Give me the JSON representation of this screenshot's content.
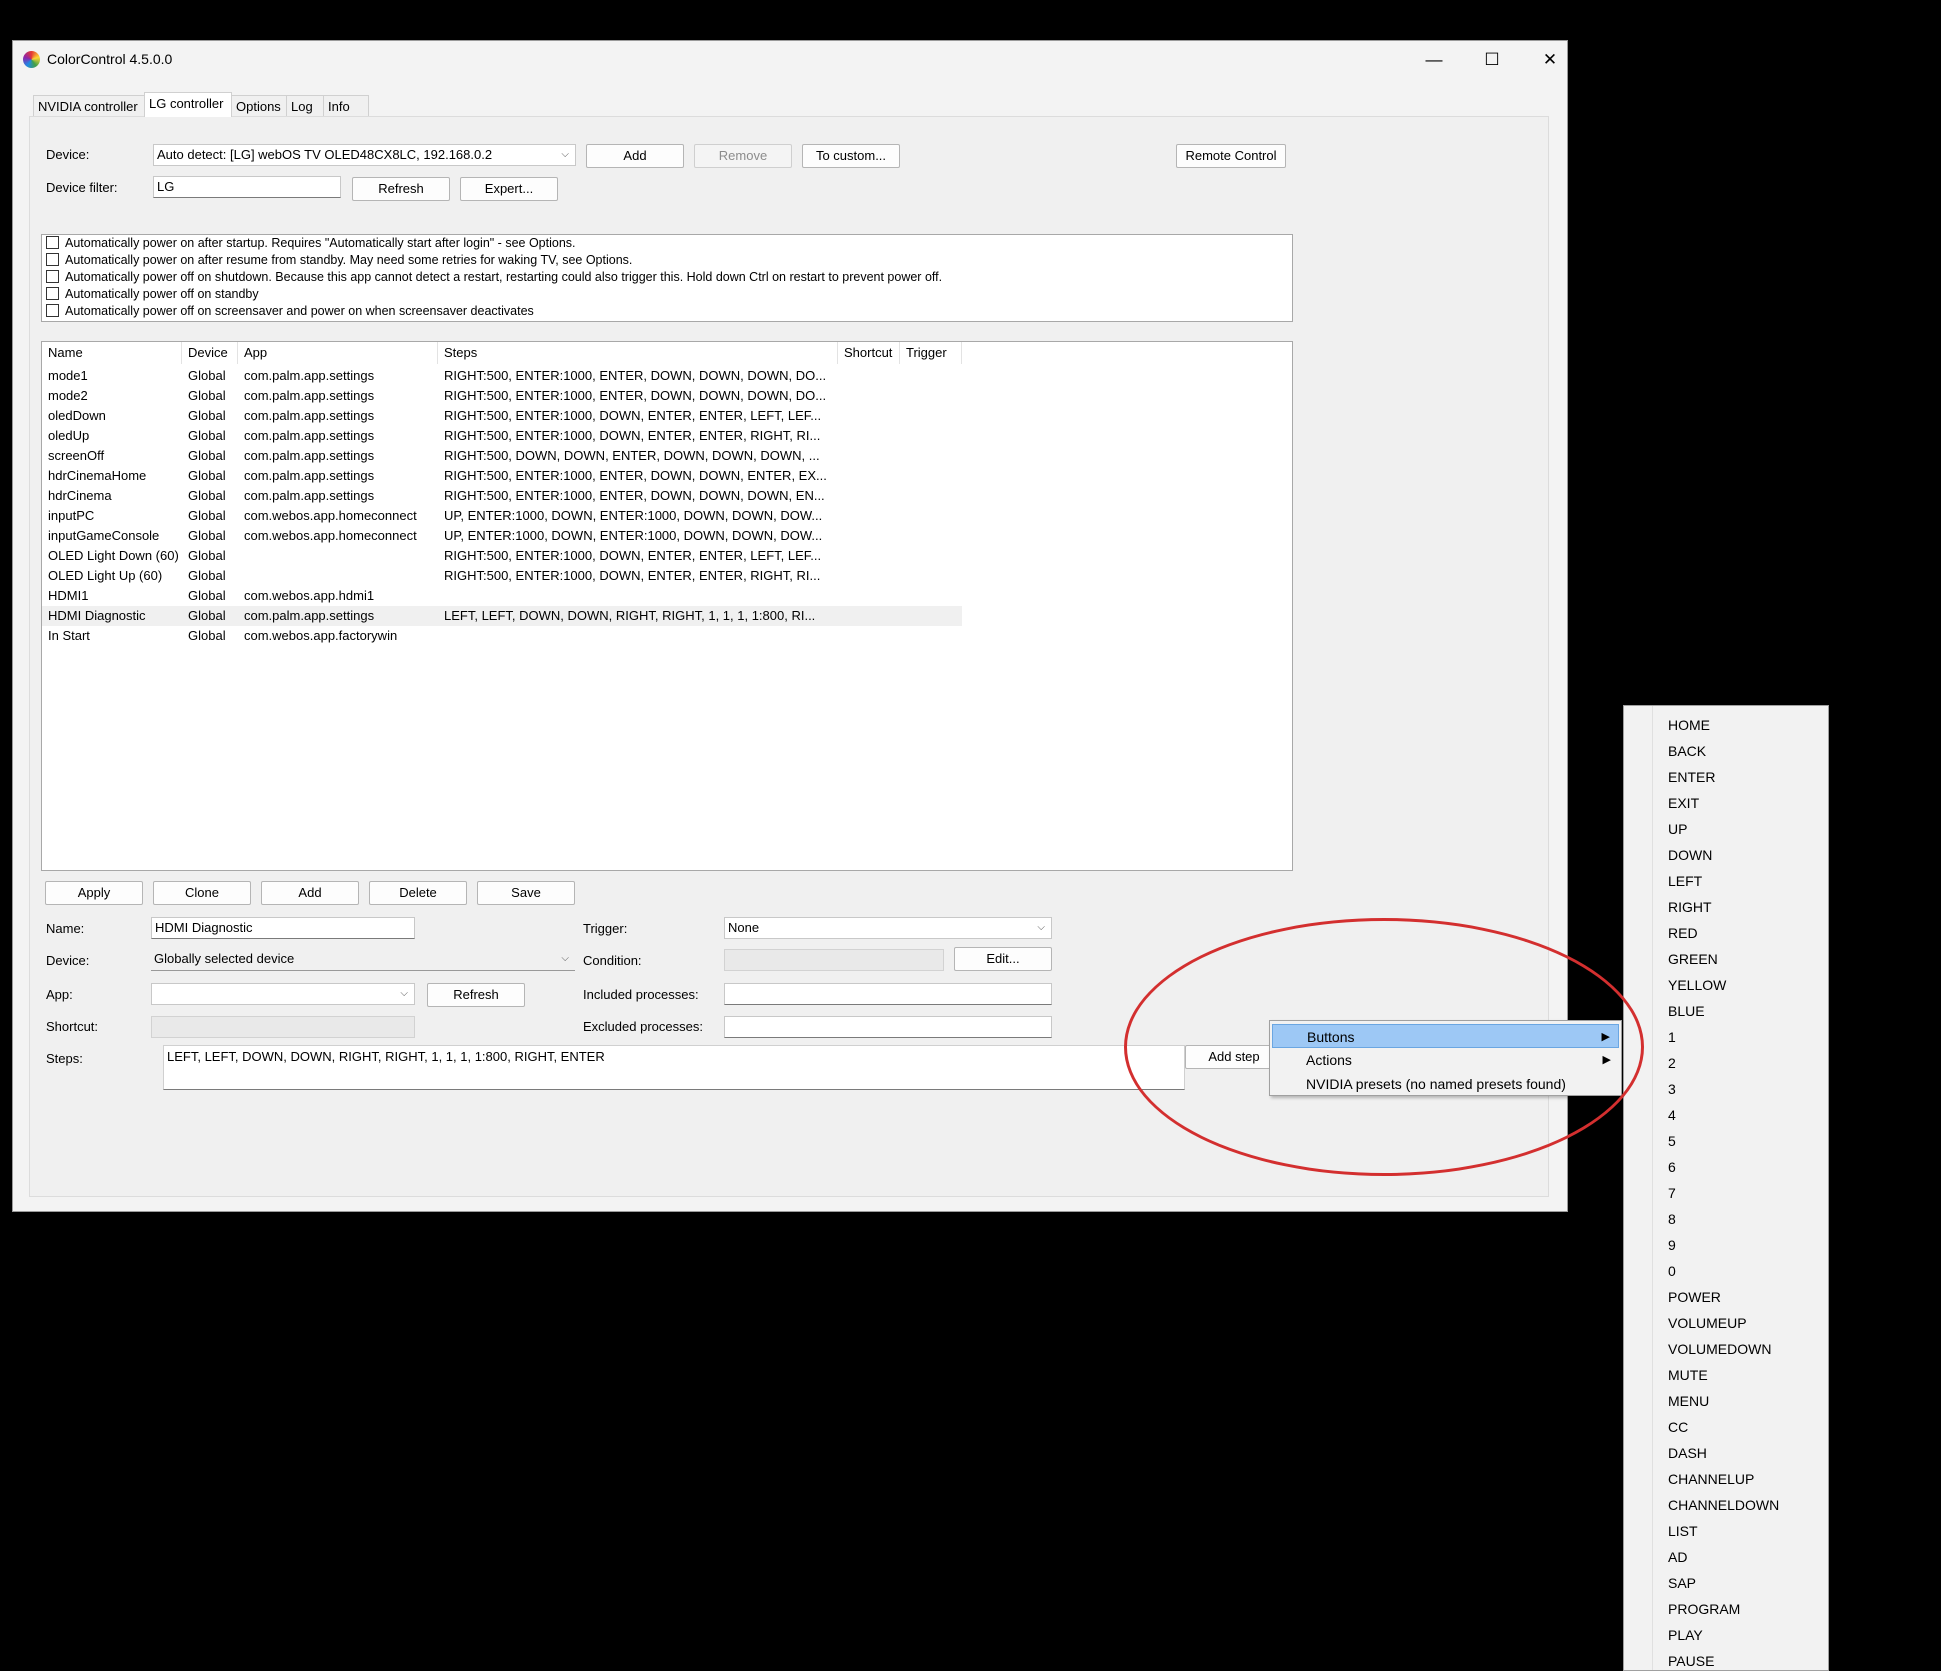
{
  "window": {
    "title": "ColorControl 4.5.0.0",
    "controls": {
      "minimize": "—",
      "maximize": "☐",
      "close": "✕"
    }
  },
  "tabs": [
    "NVIDIA controller",
    "LG controller",
    "Options",
    "Log",
    "Info"
  ],
  "active_tab": "LG controller",
  "device": {
    "label": "Device:",
    "value": "Auto detect: [LG] webOS TV OLED48CX8LC, 192.168.0.2",
    "add": "Add",
    "remove": "Remove",
    "to_custom": "To custom...",
    "remote_control": "Remote Control"
  },
  "device_filter": {
    "label": "Device filter:",
    "value": "LG",
    "refresh": "Refresh",
    "expert": "Expert..."
  },
  "power_options": [
    "Automatically power on after startup. Requires \"Automatically start after login\" - see Options.",
    "Automatically power on after resume from standby. May need some retries for waking TV, see Options.",
    "Automatically power off on shutdown. Because this app cannot detect a restart, restarting could also trigger this. Hold down Ctrl on restart to prevent power off.",
    "Automatically power off on standby",
    "Automatically power off on screensaver and power on when screensaver deactivates"
  ],
  "presets": {
    "columns": [
      "Name",
      "Device",
      "App",
      "Steps",
      "Shortcut",
      "Trigger"
    ],
    "rows": [
      [
        "mode1",
        "Global",
        "com.palm.app.settings",
        "RIGHT:500, ENTER:1000, ENTER, DOWN, DOWN, DOWN, DO..."
      ],
      [
        "mode2",
        "Global",
        "com.palm.app.settings",
        "RIGHT:500, ENTER:1000, ENTER, DOWN, DOWN, DOWN, DO..."
      ],
      [
        "oledDown",
        "Global",
        "com.palm.app.settings",
        "RIGHT:500, ENTER:1000, DOWN, ENTER, ENTER, LEFT, LEF..."
      ],
      [
        "oledUp",
        "Global",
        "com.palm.app.settings",
        "RIGHT:500, ENTER:1000, DOWN, ENTER, ENTER, RIGHT, RI..."
      ],
      [
        "screenOff",
        "Global",
        "com.palm.app.settings",
        "RIGHT:500, DOWN, DOWN, ENTER, DOWN, DOWN, DOWN, ..."
      ],
      [
        "hdrCinemaHome",
        "Global",
        "com.palm.app.settings",
        "RIGHT:500, ENTER:1000, ENTER, DOWN, DOWN, ENTER, EX..."
      ],
      [
        "hdrCinema",
        "Global",
        "com.palm.app.settings",
        "RIGHT:500, ENTER:1000, ENTER, DOWN, DOWN, DOWN, EN..."
      ],
      [
        "inputPC",
        "Global",
        "com.webos.app.homeconnect",
        "UP, ENTER:1000, DOWN, ENTER:1000, DOWN, DOWN, DOW..."
      ],
      [
        "inputGameConsole",
        "Global",
        "com.webos.app.homeconnect",
        "UP, ENTER:1000, DOWN, ENTER:1000, DOWN, DOWN, DOW..."
      ],
      [
        "OLED Light Down (60)",
        "Global",
        "",
        "RIGHT:500, ENTER:1000, DOWN, ENTER, ENTER, LEFT, LEF..."
      ],
      [
        "OLED Light Up (60)",
        "Global",
        "",
        "RIGHT:500, ENTER:1000, DOWN, ENTER, ENTER, RIGHT, RI..."
      ],
      [
        "HDMI1",
        "Global",
        "com.webos.app.hdmi1",
        ""
      ],
      [
        "HDMI Diagnostic",
        "Global",
        "com.palm.app.settings",
        "LEFT, LEFT, DOWN, DOWN, RIGHT, RIGHT, 1, 1, 1, 1:800, RI..."
      ],
      [
        "In Start",
        "Global",
        "com.webos.app.factorywin",
        ""
      ]
    ],
    "selected_index": 12
  },
  "actions": [
    "Apply",
    "Clone",
    "Add",
    "Delete",
    "Save"
  ],
  "editor": {
    "name_label": "Name:",
    "name_value": "HDMI Diagnostic",
    "device_label": "Device:",
    "device_value": "Globally selected device",
    "app_label": "App:",
    "app_value": "",
    "app_refresh": "Refresh",
    "shortcut_label": "Shortcut:",
    "steps_label": "Steps:",
    "steps_value": "LEFT, LEFT, DOWN, DOWN, RIGHT, RIGHT, 1, 1, 1, 1:800, RIGHT, ENTER",
    "trigger_label": "Trigger:",
    "trigger_value": "None",
    "condition_label": "Condition:",
    "condition_edit": "Edit...",
    "included_label": "Included processes:",
    "excluded_label": "Excluded processes:",
    "add_step": "Add step"
  },
  "context_menu": {
    "items": [
      "Buttons",
      "Actions",
      "NVIDIA presets (no named presets found)"
    ],
    "highlighted": "Buttons"
  },
  "buttons_submenu": [
    "HOME",
    "BACK",
    "ENTER",
    "EXIT",
    "UP",
    "DOWN",
    "LEFT",
    "RIGHT",
    "RED",
    "GREEN",
    "YELLOW",
    "BLUE",
    "1",
    "2",
    "3",
    "4",
    "5",
    "6",
    "7",
    "8",
    "9",
    "0",
    "POWER",
    "VOLUMEUP",
    "VOLUMEDOWN",
    "MUTE",
    "MENU",
    "CC",
    "DASH",
    "CHANNELUP",
    "CHANNELDOWN",
    "LIST",
    "AD",
    "SAP",
    "PROGRAM",
    "PLAY",
    "PAUSE"
  ],
  "colors": {
    "highlight": "#9dc8f5",
    "annotation_ellipse": "#d32f2f"
  }
}
